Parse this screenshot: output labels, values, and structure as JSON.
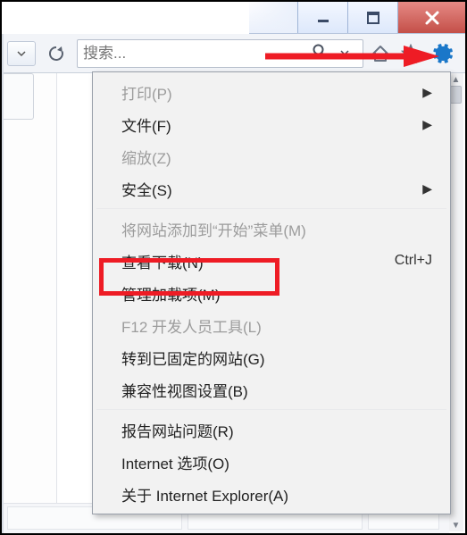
{
  "window": {
    "minimize_icon": "minimize",
    "maximize_icon": "maximize",
    "close_icon": "close"
  },
  "toolbar": {
    "nav_dropdown_icon": "chevron-down",
    "refresh_icon": "refresh",
    "search_placeholder": "搜索...",
    "search_icon": "search",
    "home_icon": "home",
    "favorites_icon": "star",
    "settings_icon": "gear"
  },
  "menu": {
    "items": [
      {
        "label": "打印(P)",
        "enabled": false,
        "submenu": true
      },
      {
        "label": "文件(F)",
        "enabled": true,
        "submenu": true
      },
      {
        "label": "缩放(Z)",
        "enabled": false,
        "submenu": false
      },
      {
        "label": "安全(S)",
        "enabled": true,
        "submenu": true
      },
      {
        "sep": true
      },
      {
        "label": "将网站添加到“开始”菜单(M)",
        "enabled": false
      },
      {
        "label": "查看下载(N)",
        "enabled": true,
        "shortcut": "Ctrl+J"
      },
      {
        "label": "管理加载项(M)",
        "enabled": true,
        "highlighted": true
      },
      {
        "label": "F12 开发人员工具(L)",
        "enabled": false
      },
      {
        "label": "转到已固定的网站(G)",
        "enabled": true
      },
      {
        "label": "兼容性视图设置(B)",
        "enabled": true
      },
      {
        "sep": true
      },
      {
        "label": "报告网站问题(R)",
        "enabled": true
      },
      {
        "label": "Internet 选项(O)",
        "enabled": true
      },
      {
        "label": "关于 Internet Explorer(A)",
        "enabled": true
      }
    ]
  }
}
